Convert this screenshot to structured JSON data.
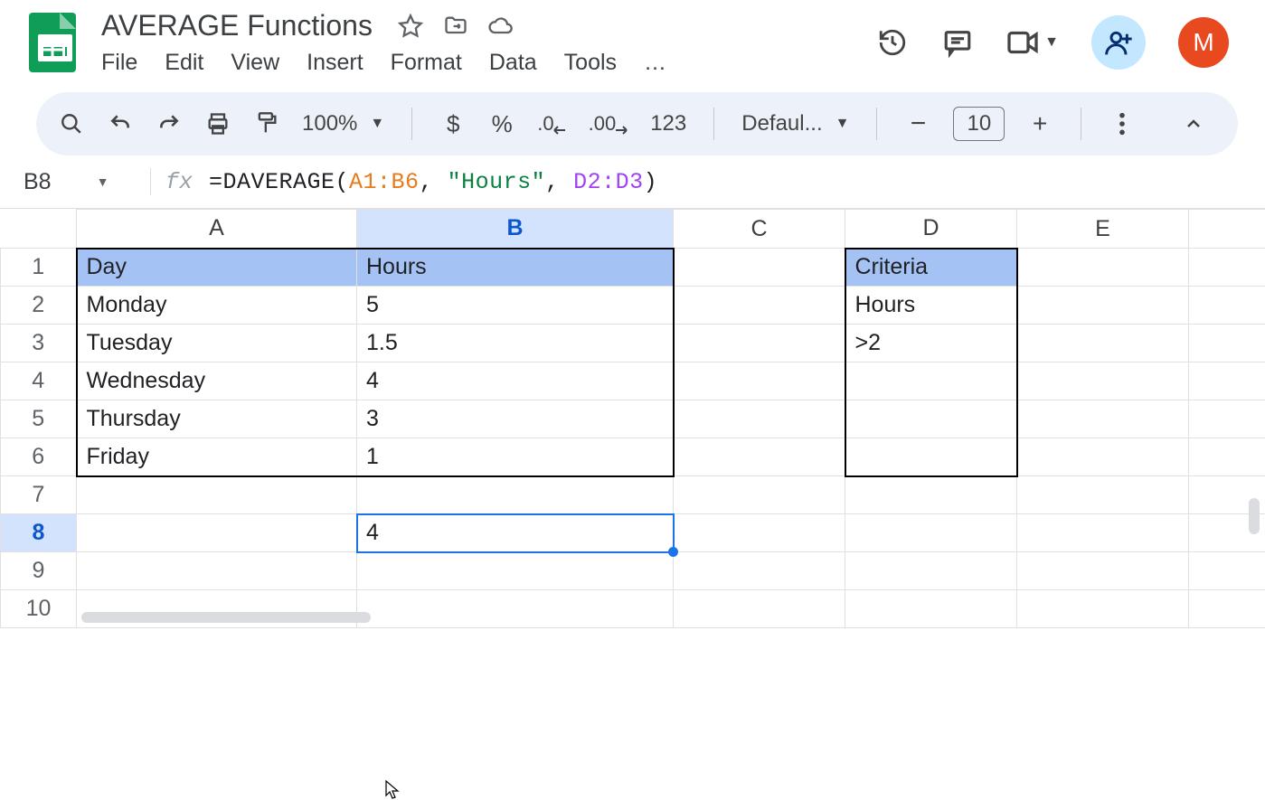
{
  "doc": {
    "title": "AVERAGE Functions"
  },
  "menubar": [
    "File",
    "Edit",
    "View",
    "Insert",
    "Format",
    "Data",
    "Tools",
    "…"
  ],
  "avatar": "M",
  "toolbar": {
    "zoom": "100%",
    "font": "Defaul...",
    "size": "10"
  },
  "formula": {
    "cell_ref": "B8",
    "func": "=DAVERAGE(",
    "ref1": "A1:B6",
    "comma1": ", ",
    "str": "\"Hours\"",
    "comma2": ", ",
    "ref2": "D2:D3",
    "close": ")"
  },
  "columns": [
    "A",
    "B",
    "C",
    "D",
    "E",
    ""
  ],
  "rows": [
    "1",
    "2",
    "3",
    "4",
    "5",
    "6",
    "7",
    "8",
    "9",
    "10"
  ],
  "cells": {
    "A1": "Day",
    "B1": "Hours",
    "D1": "Criteria",
    "A2": "Monday",
    "B2": "5",
    "D2": "Hours",
    "A3": "Tuesday",
    "B3": "1.5",
    "D3": ">2",
    "A4": "Wednesday",
    "B4": "4",
    "A5": "Thursday",
    "B5": "3",
    "A6": "Friday",
    "B6": "1",
    "B8": "4"
  },
  "chart_data": {
    "type": "table",
    "title": "AVERAGE Functions",
    "active_cell": "B8",
    "formula": "=DAVERAGE(A1:B6, \"Hours\", D2:D3)",
    "main_table": {
      "headers": [
        "Day",
        "Hours"
      ],
      "rows": [
        [
          "Monday",
          5
        ],
        [
          "Tuesday",
          1.5
        ],
        [
          "Wednesday",
          4
        ],
        [
          "Thursday",
          3
        ],
        [
          "Friday",
          1
        ]
      ]
    },
    "criteria_table": {
      "headers": [
        "Criteria"
      ],
      "rows": [
        [
          "Hours"
        ],
        [
          ">2"
        ]
      ]
    },
    "result": 4
  }
}
